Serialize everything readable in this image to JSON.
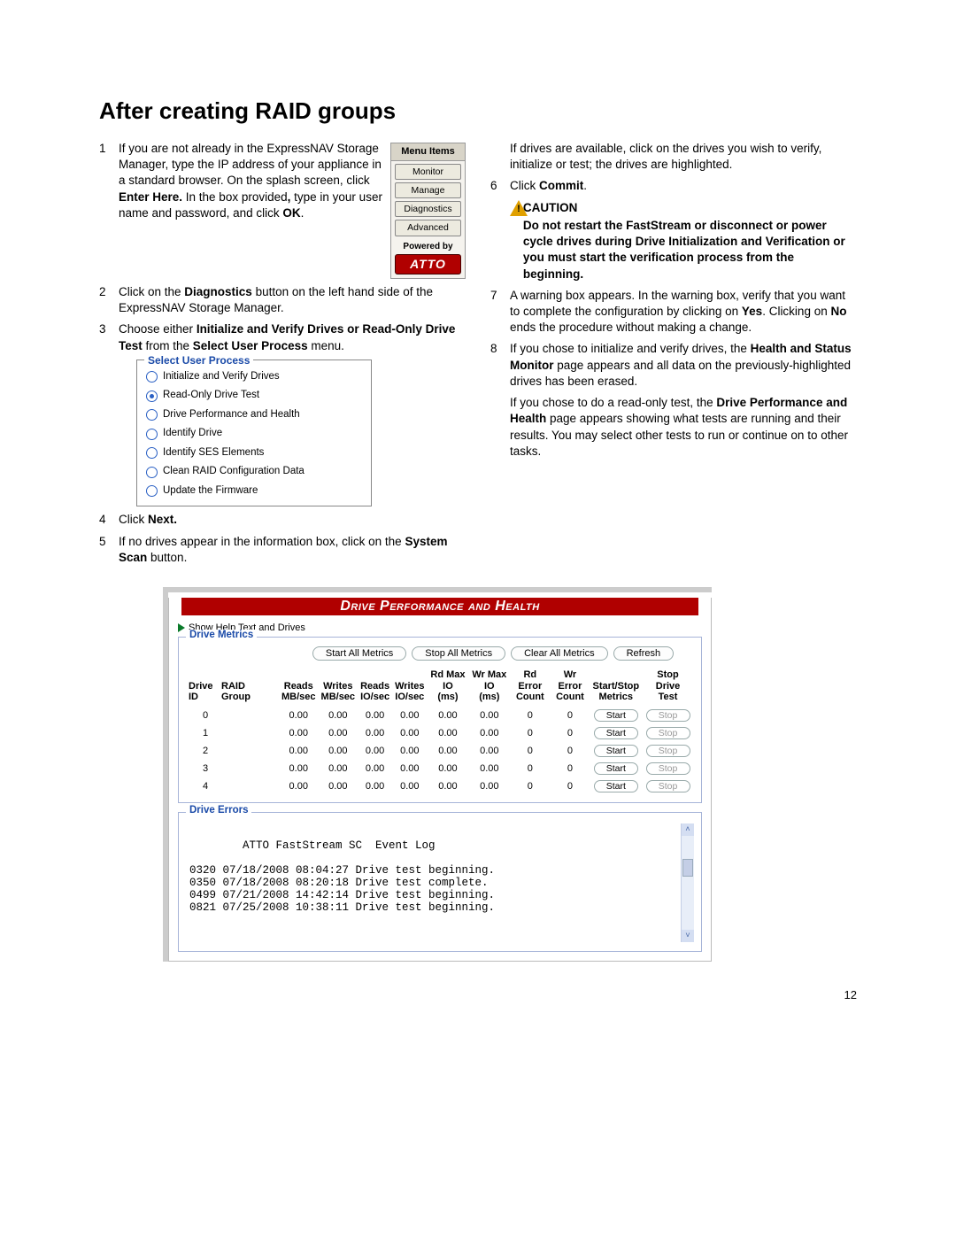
{
  "heading": "After creating RAID groups",
  "pageNumber": "12",
  "left": {
    "step1": {
      "num": "1",
      "text_a": "If you are not already in the ExpressNAV Storage Manager, type the IP address of your appliance in a standard browser. On the splash screen, click ",
      "bold_a": "Enter Here.",
      "text_b": " In the box provided",
      "bold_comma": ",",
      "text_c": " type in your user name and password, and click ",
      "bold_b": "OK",
      "text_d": "."
    },
    "step2": {
      "num": "2",
      "text_a": "Click on the ",
      "bold": "Diagnostics",
      "text_b": " button on the left hand side of the ExpressNAV Storage Manager."
    },
    "step3": {
      "num": "3",
      "text_a": "Choose either ",
      "bold_a": "Initialize and Verify Drives or Read-Only Drive Test",
      "text_b": " from the ",
      "bold_b": "Select User Process",
      "text_c": " menu."
    },
    "step4": {
      "num": "4",
      "text_a": "Click ",
      "bold": "Next."
    },
    "step5": {
      "num": "5",
      "text_a": "If no drives appear in the information box, click on the ",
      "bold": "System Scan",
      "text_b": " button."
    }
  },
  "menu": {
    "header": "Menu Items",
    "items": [
      "Monitor",
      "Manage",
      "Diagnostics",
      "Advanced"
    ],
    "powered": "Powered by",
    "brand": "ATTO"
  },
  "sup": {
    "legend": "Select User Process",
    "options": [
      {
        "label": "Initialize and Verify Drives",
        "selected": false
      },
      {
        "label": "Read-Only Drive Test",
        "selected": true
      },
      {
        "label": "Drive Performance and Health",
        "selected": false
      },
      {
        "label": "Identify Drive",
        "selected": false
      },
      {
        "label": "Identify SES Elements",
        "selected": false
      },
      {
        "label": "Clean RAID Configuration Data",
        "selected": false
      },
      {
        "label": "Update the Firmware",
        "selected": false
      }
    ]
  },
  "right": {
    "cont5": "If drives are available, click on the drives you wish to verify, initialize or test; the drives are highlighted.",
    "step6": {
      "num": "6",
      "text_a": "Click ",
      "bold": "Commit",
      "text_b": "."
    },
    "caution": {
      "title": "CAUTION",
      "text": "Do not restart the FastStream or disconnect or power cycle drives during Drive Initialization and Verification or you must start the verification process from the beginning."
    },
    "step7": {
      "num": "7",
      "text_a": "A warning box appears. In the warning box, verify that you want to complete the configuration by clicking on ",
      "bold_a": "Yes",
      "text_b": ". Clicking on ",
      "bold_b": "No",
      "text_c": " ends the procedure without making a change."
    },
    "step8": {
      "num": "8",
      "text_a": "If you chose to initialize and verify drives, the ",
      "bold": "Health and Status Monitor",
      "text_b": " page appears and all data on the previously-highlighted drives has been erased."
    },
    "cont8": {
      "text_a": "If you chose to do a read-only test, the ",
      "bold": "Drive Performance and Health",
      "text_b": " page appears showing what tests are running and their results. You may select other tests to run or continue on to other tasks."
    }
  },
  "dph": {
    "title": "Drive Performance and Health",
    "showHelp": "Show Help Text and Drives",
    "metrics": {
      "legend": "Drive Metrics",
      "buttons": [
        "Start All Metrics",
        "Stop All Metrics",
        "Clear All Metrics",
        "Refresh"
      ],
      "headers": [
        "Drive ID",
        "RAID Group",
        "Reads MB/sec",
        "Writes MB/sec",
        "Reads IO/sec",
        "Writes IO/sec",
        "Rd Max IO (ms)",
        "Wr Max IO (ms)",
        "Rd Error Count",
        "Wr Error Count",
        "Start/Stop Metrics",
        "Stop Drive Test"
      ],
      "rows": [
        {
          "id": "0",
          "rg": "",
          "r": "0.00",
          "w": "0.00",
          "ri": "0.00",
          "wi": "0.00",
          "rm": "0.00",
          "wm": "0.00",
          "re": "0",
          "we": "0",
          "start": "Start",
          "stop": "Stop"
        },
        {
          "id": "1",
          "rg": "",
          "r": "0.00",
          "w": "0.00",
          "ri": "0.00",
          "wi": "0.00",
          "rm": "0.00",
          "wm": "0.00",
          "re": "0",
          "we": "0",
          "start": "Start",
          "stop": "Stop"
        },
        {
          "id": "2",
          "rg": "",
          "r": "0.00",
          "w": "0.00",
          "ri": "0.00",
          "wi": "0.00",
          "rm": "0.00",
          "wm": "0.00",
          "re": "0",
          "we": "0",
          "start": "Start",
          "stop": "Stop"
        },
        {
          "id": "3",
          "rg": "",
          "r": "0.00",
          "w": "0.00",
          "ri": "0.00",
          "wi": "0.00",
          "rm": "0.00",
          "wm": "0.00",
          "re": "0",
          "we": "0",
          "start": "Start",
          "stop": "Stop"
        },
        {
          "id": "4",
          "rg": "",
          "r": "0.00",
          "w": "0.00",
          "ri": "0.00",
          "wi": "0.00",
          "rm": "0.00",
          "wm": "0.00",
          "re": "0",
          "we": "0",
          "start": "Start",
          "stop": "Stop"
        }
      ]
    },
    "errors": {
      "legend": "Drive Errors",
      "log": "ATTO FastStream SC  Event Log\n\n0320 07/18/2008 08:04:27 Drive test beginning.\n0350 07/18/2008 08:20:18 Drive test complete.\n0499 07/21/2008 14:42:14 Drive test beginning.\n0821 07/25/2008 10:38:11 Drive test beginning."
    }
  }
}
